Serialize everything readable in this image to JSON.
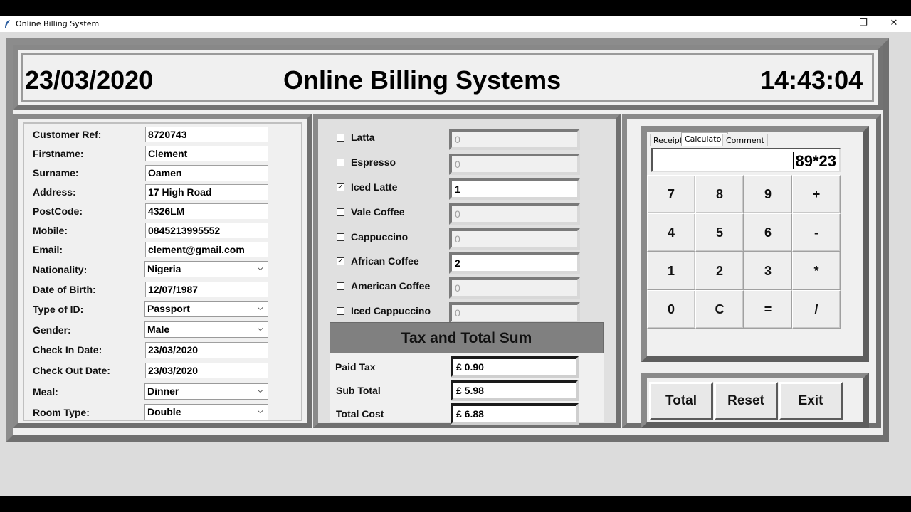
{
  "window": {
    "title": "Online Billing System",
    "minimize": "—",
    "restore": "❐",
    "close": "✕"
  },
  "header": {
    "date": "23/03/2020",
    "title": "Online Billing Systems",
    "time": "14:43:04"
  },
  "customer": {
    "fields": [
      {
        "label": "Customer Ref:",
        "value": "8720743"
      },
      {
        "label": "Firstname:",
        "value": "Clement"
      },
      {
        "label": "Surname:",
        "value": "Oamen"
      },
      {
        "label": "Address:",
        "value": "17 High Road"
      },
      {
        "label": "PostCode:",
        "value": "4326LM"
      },
      {
        "label": "Mobile:",
        "value": "0845213995552"
      },
      {
        "label": "Email:",
        "value": "clement@gmail.com"
      },
      {
        "label": "Nationality:",
        "value": "Nigeria"
      },
      {
        "label": "Date of Birth:",
        "value": "12/07/1987"
      },
      {
        "label": "Type of ID:",
        "value": "Passport"
      },
      {
        "label": "Gender:",
        "value": "Male"
      },
      {
        "label": "Check In Date:",
        "value": "23/03/2020"
      },
      {
        "label": "Check Out Date:",
        "value": "23/03/2020"
      },
      {
        "label": "Meal:",
        "value": "Dinner"
      },
      {
        "label": "Room Type:",
        "value": "Double"
      }
    ]
  },
  "drinks": {
    "items": [
      {
        "label": "Latta",
        "checked": "",
        "qty": "0"
      },
      {
        "label": "Espresso",
        "checked": "",
        "qty": "0"
      },
      {
        "label": "Iced Latte",
        "checked": "✓",
        "qty": "1"
      },
      {
        "label": "Vale Coffee",
        "checked": "",
        "qty": "0"
      },
      {
        "label": "Cappuccino",
        "checked": "",
        "qty": "0"
      },
      {
        "label": "African Coffee",
        "checked": "✓",
        "qty": "2"
      },
      {
        "label": "American Coffee",
        "checked": "",
        "qty": "0"
      },
      {
        "label": "Iced Cappuccino",
        "checked": "",
        "qty": "0"
      }
    ]
  },
  "totals": {
    "title": "Tax and Total Sum",
    "paid_tax_label": "Paid Tax",
    "paid_tax": "£ 0.90",
    "sub_total_label": "Sub Total",
    "sub_total": "£ 5.98",
    "total_cost_label": "Total Cost",
    "total_cost": "£ 6.88"
  },
  "calculator": {
    "tabs": [
      "Receipt",
      "Calculator",
      "Comment"
    ],
    "display": "89*23",
    "keys": [
      "7",
      "8",
      "9",
      "+",
      "4",
      "5",
      "6",
      "-",
      "1",
      "2",
      "3",
      "*",
      "0",
      "C",
      "=",
      "/"
    ]
  },
  "actions": {
    "total": "Total",
    "reset": "Reset",
    "exit": "Exit"
  }
}
